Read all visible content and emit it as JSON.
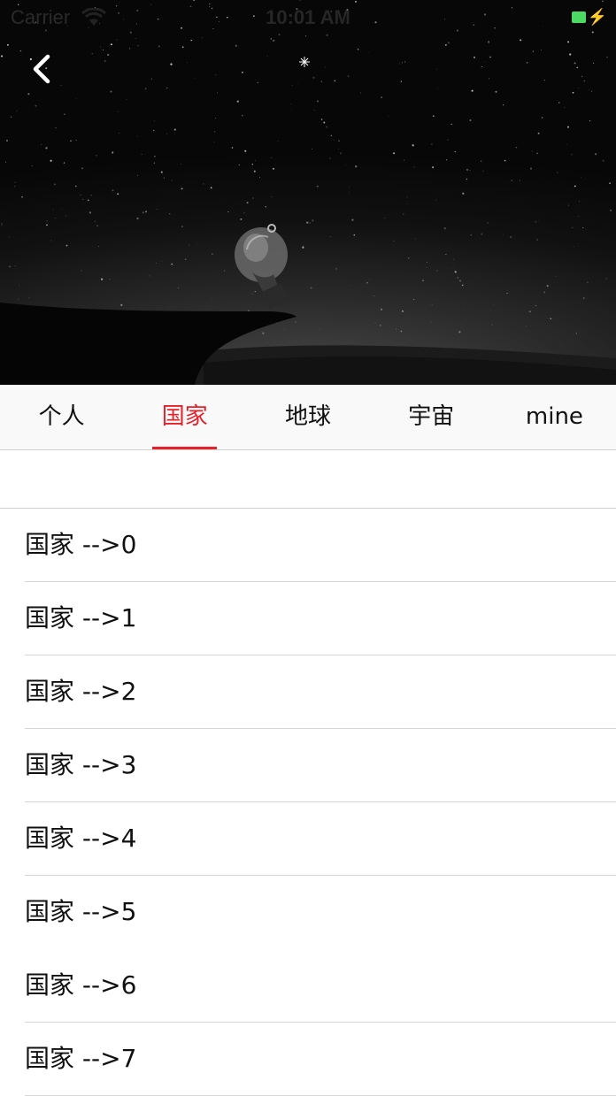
{
  "status_bar": {
    "carrier": "Carrier",
    "time": "10:01 AM",
    "battery_color": "#4cd964"
  },
  "header": {
    "back_icon": "chevron-left-icon",
    "image": "night-sky-lightbulb"
  },
  "tabs": [
    {
      "label": "个人",
      "active": false
    },
    {
      "label": "国家",
      "active": true
    },
    {
      "label": "地球",
      "active": false
    },
    {
      "label": "宇宙",
      "active": false
    },
    {
      "label": "mine",
      "active": false
    }
  ],
  "accent_color": "#e8202a",
  "list": {
    "items": [
      "国家 -->0",
      "国家 -->1",
      "国家 -->2",
      "国家 -->3",
      "国家 -->4",
      "国家 -->5",
      "国家 -->6",
      "国家 -->7"
    ]
  }
}
